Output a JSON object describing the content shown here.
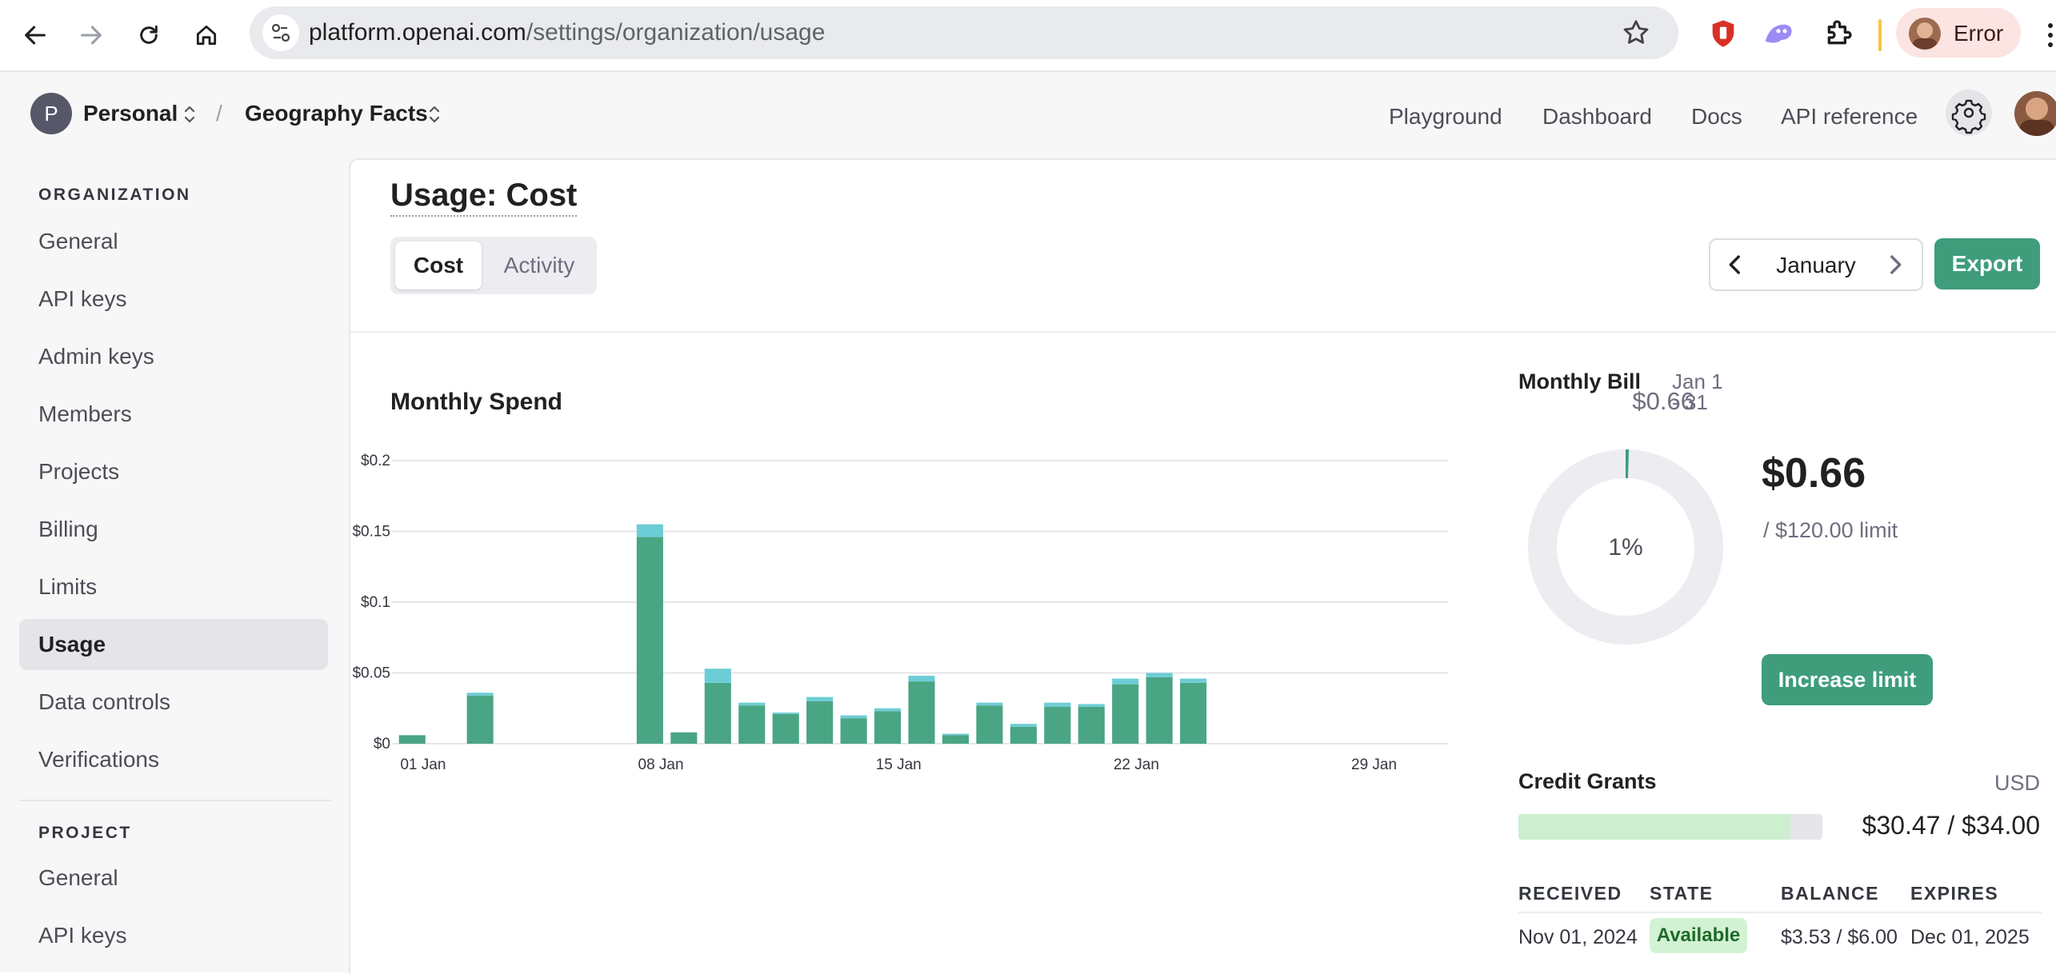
{
  "browser": {
    "url_host": "platform.openai.com",
    "url_path": "/settings/organization/usage",
    "profile_label": "Error",
    "icons": [
      "back-arrow-icon",
      "forward-arrow-icon",
      "reload-icon",
      "home-icon",
      "site-info-icon",
      "bookmark-star-icon",
      "extension-shield-icon",
      "extension-ghost-icon",
      "extensions-puzzle-icon",
      "kebab-menu-icon"
    ]
  },
  "topnav": {
    "org_initial": "P",
    "org_name": "Personal",
    "separator": "/",
    "project_name": "Geography Facts",
    "links": [
      "Playground",
      "Dashboard",
      "Docs",
      "API reference"
    ]
  },
  "sidebar": {
    "org_heading": "ORGANIZATION",
    "org_items": [
      "General",
      "API keys",
      "Admin keys",
      "Members",
      "Projects",
      "Billing",
      "Limits",
      "Usage",
      "Data controls",
      "Verifications"
    ],
    "active_item": "Usage",
    "project_heading": "PROJECT",
    "project_items": [
      "General",
      "API keys"
    ]
  },
  "page": {
    "title": "Usage: Cost",
    "tabs": [
      "Cost",
      "Activity"
    ],
    "active_tab": "Cost",
    "month": "January",
    "export_label": "Export"
  },
  "monthly_spend": {
    "title": "Monthly Spend",
    "total": "$0.66"
  },
  "chart_data": {
    "type": "bar",
    "stacked": true,
    "y_tick_labels": [
      "$0",
      "$0.05",
      "$0.1",
      "$0.15",
      "$0.2"
    ],
    "ylim": [
      0,
      0.2
    ],
    "x_tick_labels": [
      "01 Jan",
      "08 Jan",
      "15 Jan",
      "22 Jan",
      "29 Jan"
    ],
    "x_tick_days": [
      1,
      8,
      15,
      22,
      29
    ],
    "days_in_month": 31,
    "grid": true,
    "colors": [
      "#4aa584",
      "#6ccdd6"
    ],
    "series": [
      {
        "values": [
          0.006,
          0,
          0.034,
          0,
          0,
          0,
          0,
          0.146,
          0.008,
          0.043,
          0.027,
          0.021,
          0.03,
          0.018,
          0.023,
          0.044,
          0.006,
          0.027,
          0.012,
          0.026,
          0.026,
          0.042,
          0.047,
          0.043,
          0,
          0,
          0,
          0,
          0,
          0,
          0
        ]
      },
      {
        "values": [
          0,
          0,
          0.002,
          0,
          0,
          0,
          0,
          0.009,
          0,
          0.01,
          0.002,
          0.001,
          0.003,
          0.002,
          0.002,
          0.004,
          0.001,
          0.002,
          0.002,
          0.003,
          0.002,
          0.004,
          0.003,
          0.003,
          0,
          0,
          0,
          0,
          0,
          0,
          0
        ]
      }
    ]
  },
  "monthly_bill": {
    "title": "Monthly Bill",
    "range_line1": "Jan 1",
    "range_line2": "- 31",
    "amount": "$0.66",
    "limit": "/ $120.00 limit",
    "percent_label": "1%",
    "percent_used": 0.55,
    "increase_label": "Increase limit"
  },
  "credit_grants": {
    "title": "Credit Grants",
    "currency": "USD",
    "summary": "$30.47 / $34.00",
    "fill_fraction": 0.896,
    "columns": [
      "RECEIVED",
      "STATE",
      "BALANCE",
      "EXPIRES"
    ],
    "rows": [
      {
        "received": "Nov 01, 2024",
        "state": "Available",
        "balance": "$3.53 / $6.00",
        "expires": "Dec 01, 2025"
      }
    ]
  }
}
